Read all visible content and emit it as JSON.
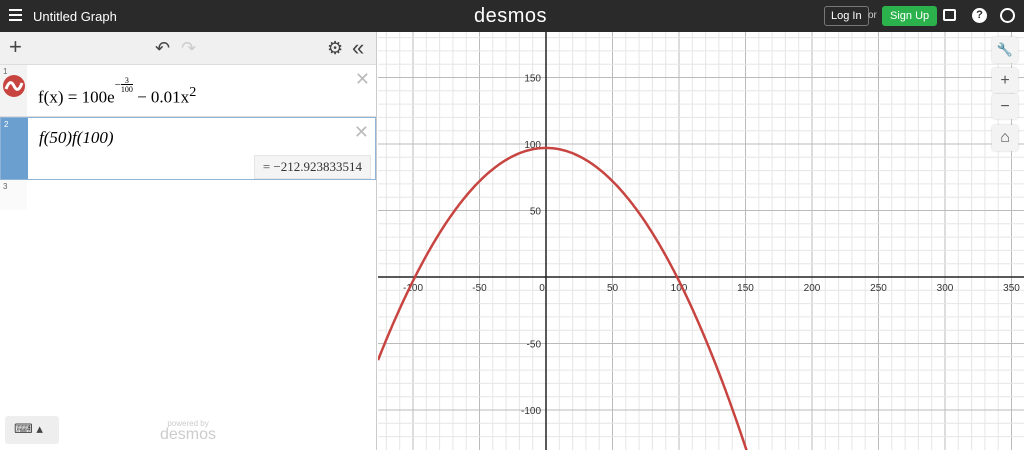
{
  "header": {
    "title": "Untitled Graph",
    "logo": "desmos",
    "login": "Log In",
    "or": "or",
    "signup": "Sign Up",
    "signup_color": "#2bb24c"
  },
  "toolbar": {
    "add": "+",
    "undo": "↶",
    "redo": "↷",
    "settings": "⚙",
    "collapse": "«"
  },
  "expressions": [
    {
      "num": "1",
      "lhs": "f(x) = 100e",
      "exp_num": "3",
      "exp_den": "100",
      "rhs": " − 0.01x",
      "pow": "2",
      "color": "#c74440"
    },
    {
      "num": "2",
      "text": "f(50)f(100)",
      "result": "= −212.923833514"
    },
    {
      "num": "3"
    }
  ],
  "footer": {
    "keyboard": "⌨ ▴",
    "powered": "powered by",
    "brand": "desmos"
  },
  "graph_controls": {
    "wrench": "🔧",
    "zoom_in": "+",
    "zoom_out": "−",
    "home": "⌂"
  },
  "graph": {
    "function": {
      "a": 100,
      "exp": -0.03,
      "c": -0.01,
      "color": "#c74440"
    },
    "x_ticks": [
      "-100",
      "-50",
      "0",
      "50",
      "100",
      "150",
      "200",
      "250",
      "300",
      "350"
    ],
    "x_tick_values": [
      -100,
      -50,
      0,
      50,
      100,
      150,
      200,
      250,
      300,
      350
    ],
    "y_ticks": [
      "150",
      "100",
      "50",
      "-50",
      "-100"
    ],
    "y_tick_values": [
      150,
      100,
      50,
      -50,
      -100
    ],
    "xlim": [
      -126,
      360
    ],
    "ylim": [
      -130,
      184
    ]
  }
}
